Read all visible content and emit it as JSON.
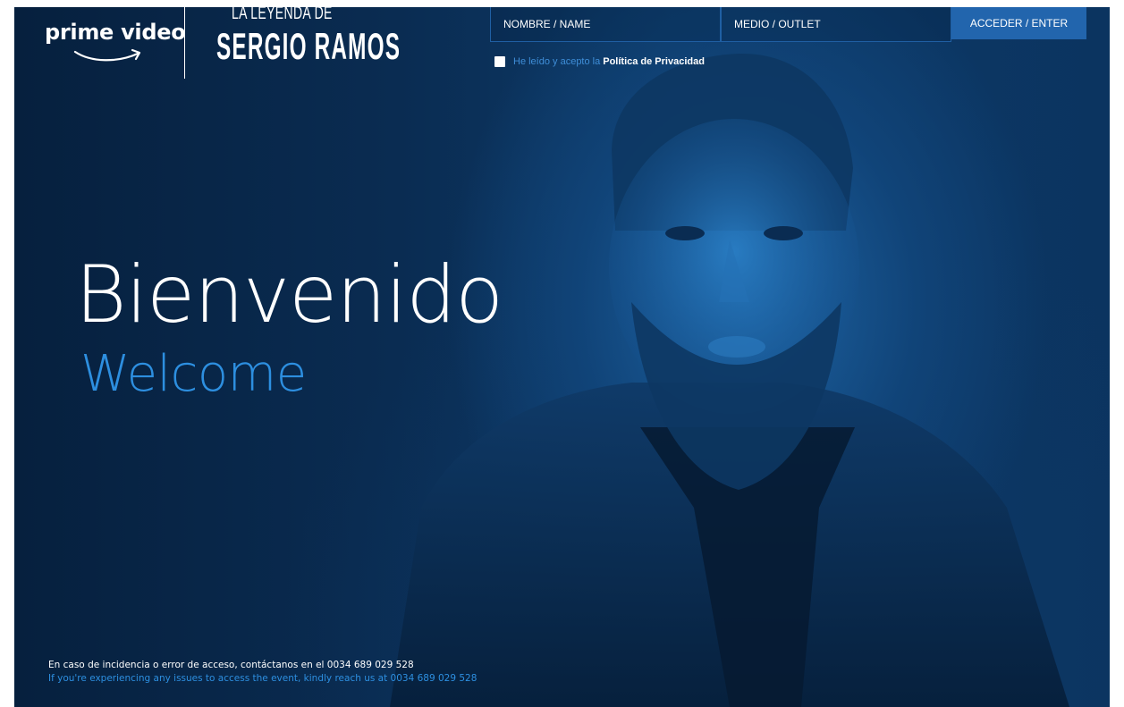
{
  "header": {
    "brand": "prime video",
    "show_logo": {
      "top": "LA LEYENDA DE",
      "main": "SERGIO RAMOS"
    }
  },
  "form": {
    "name_placeholder": "NOMBRE / NAME",
    "outlet_placeholder": "MEDIO / OUTLET",
    "enter_label": "ACCEDER / ENTER",
    "privacy_text": "He leído y acepto la",
    "privacy_link": "Política de Privacidad"
  },
  "hero": {
    "title": "Bienvenido",
    "subtitle": "Welcome"
  },
  "footer": {
    "line_es": "En caso de incidencia o error de acceso, contáctanos en el 0034 689 029 528",
    "line_en": "If you're experiencing any issues to access the event, kindly reach us at 0034 689 029 528"
  },
  "colors": {
    "background": "#0a2c52",
    "accent_blue": "#2d8fe0",
    "button_blue": "#2265ad"
  },
  "icons": {
    "checkbox": "checkbox-icon",
    "smile": "amazon-smile-icon"
  }
}
